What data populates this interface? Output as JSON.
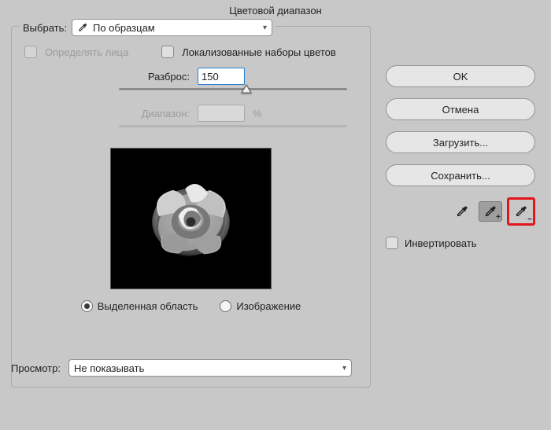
{
  "title": "Цветовой диапазон",
  "select_legend": "Выбрать:",
  "select_value": "По образцам",
  "detect_faces": "Определять лица",
  "localized": "Локализованные наборы цветов",
  "fuzziness_label": "Разброс:",
  "fuzziness_value": "150",
  "range_label": "Диапазон:",
  "range_value": "",
  "range_unit": "%",
  "preview_modes": {
    "selection": "Выделенная область",
    "image": "Изображение"
  },
  "buttons": {
    "ok": "OK",
    "cancel": "Отмена",
    "load": "Загрузить...",
    "save": "Сохранить..."
  },
  "invert": "Инвертировать",
  "preview_label": "Просмотр:",
  "preview_value": "Не показывать"
}
